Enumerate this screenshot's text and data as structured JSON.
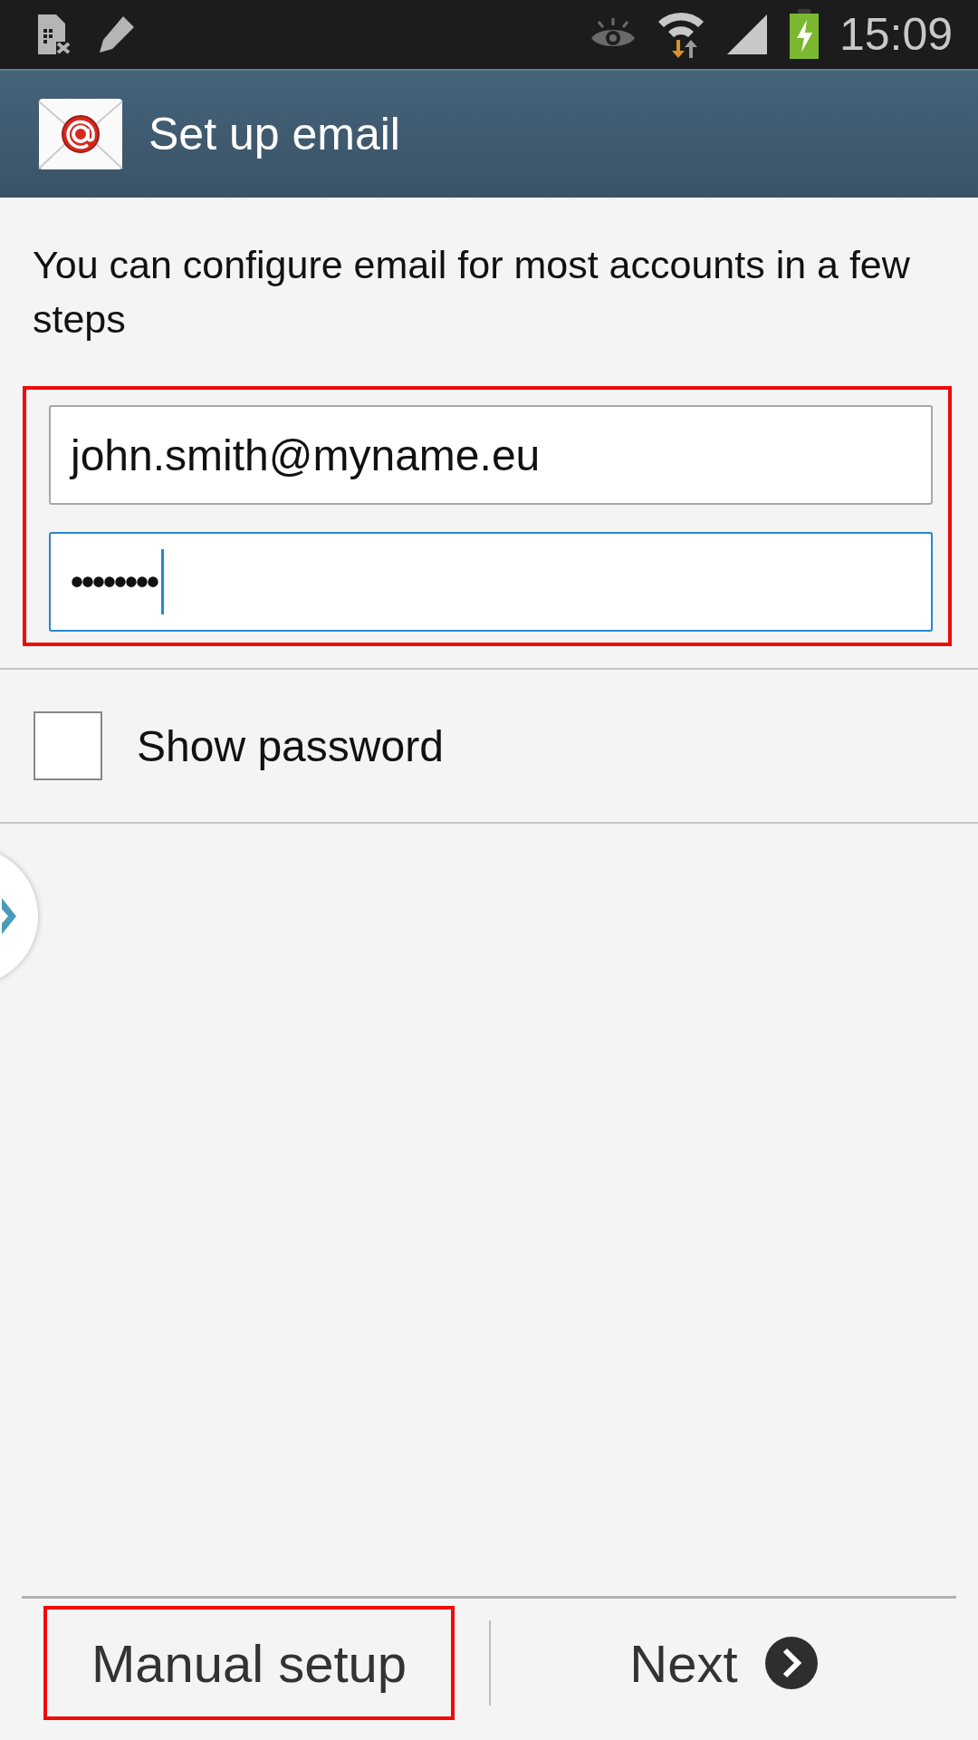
{
  "status_bar": {
    "time": "15:09"
  },
  "header": {
    "title": "Set up email"
  },
  "intro": "You can configure email for most accounts in a few steps",
  "credentials": {
    "highlighted": true,
    "fields": [
      {
        "kind": "email",
        "value": "john.smith@myname.eu",
        "focused": false
      },
      {
        "kind": "password",
        "value": "••••••••",
        "focused": true
      }
    ]
  },
  "show_password": {
    "label": "Show password",
    "checked": false
  },
  "bottom_buttons": [
    {
      "label": "Manual setup",
      "kind": "plain",
      "highlighted": true
    },
    {
      "label": "Next",
      "kind": "next",
      "highlighted": false
    }
  ]
}
